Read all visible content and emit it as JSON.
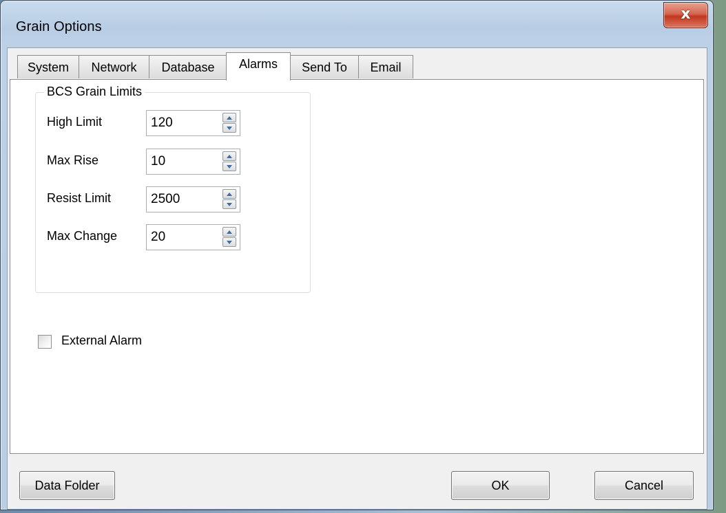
{
  "window": {
    "title": "Grain Options",
    "close_glyph": "x"
  },
  "tabs": [
    {
      "label": "System",
      "active": false
    },
    {
      "label": "Network",
      "active": false
    },
    {
      "label": "Database",
      "active": false
    },
    {
      "label": "Alarms",
      "active": true
    },
    {
      "label": "Send To",
      "active": false
    },
    {
      "label": "Email",
      "active": false
    }
  ],
  "alarms": {
    "group_title": "BCS Grain Limits",
    "fields": [
      {
        "label": "High Limit",
        "value": "120"
      },
      {
        "label": "Max Rise",
        "value": "10"
      },
      {
        "label": "Resist Limit",
        "value": "2500"
      },
      {
        "label": "Max Change",
        "value": "20"
      }
    ],
    "external_alarm": {
      "label": "External Alarm",
      "checked": false
    }
  },
  "buttons": {
    "data_folder": "Data Folder",
    "ok": "OK",
    "cancel": "Cancel"
  },
  "icons": {
    "close": "close-icon",
    "spin_up": "spin-up-arrow-icon",
    "spin_down": "spin-down-arrow-icon"
  }
}
